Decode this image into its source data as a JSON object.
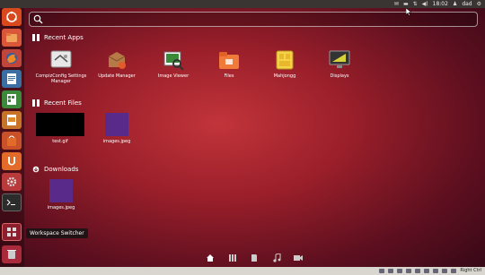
{
  "top_panel": {
    "time": "18:02",
    "user": "dad",
    "icons": [
      "mail-icon",
      "battery-icon",
      "network-icon",
      "volume-icon",
      "user-icon",
      "gear-icon"
    ]
  },
  "search": {
    "placeholder": "",
    "value": ""
  },
  "sections": {
    "recent_apps": {
      "title": "Recent Apps",
      "items": [
        {
          "label": "CompizConfig Settings Manager",
          "icon": "compizconfig-icon"
        },
        {
          "label": "Update Manager",
          "icon": "update-manager-icon"
        },
        {
          "label": "Image Viewer",
          "icon": "image-viewer-icon"
        },
        {
          "label": "Files",
          "icon": "files-icon"
        },
        {
          "label": "Mahjongg",
          "icon": "mahjongg-icon"
        },
        {
          "label": "Displays",
          "icon": "displays-icon"
        }
      ]
    },
    "recent_files": {
      "title": "Recent Files",
      "items": [
        {
          "label": "test.gif"
        },
        {
          "label": "images.jpeg"
        }
      ]
    },
    "downloads": {
      "title": "Downloads",
      "items": [
        {
          "label": "images.jpeg"
        }
      ]
    }
  },
  "tooltip": {
    "text": "Workspace Switcher"
  },
  "lenses": [
    "home-icon",
    "applications-icon",
    "files-icon",
    "music-icon",
    "video-icon"
  ],
  "bottom_panel": {
    "right_ctrl": "Right Ctrl"
  },
  "colors": {
    "accent": "#dd4814",
    "launcher_bg": "#2a0a10",
    "panel": "#3a3532"
  }
}
